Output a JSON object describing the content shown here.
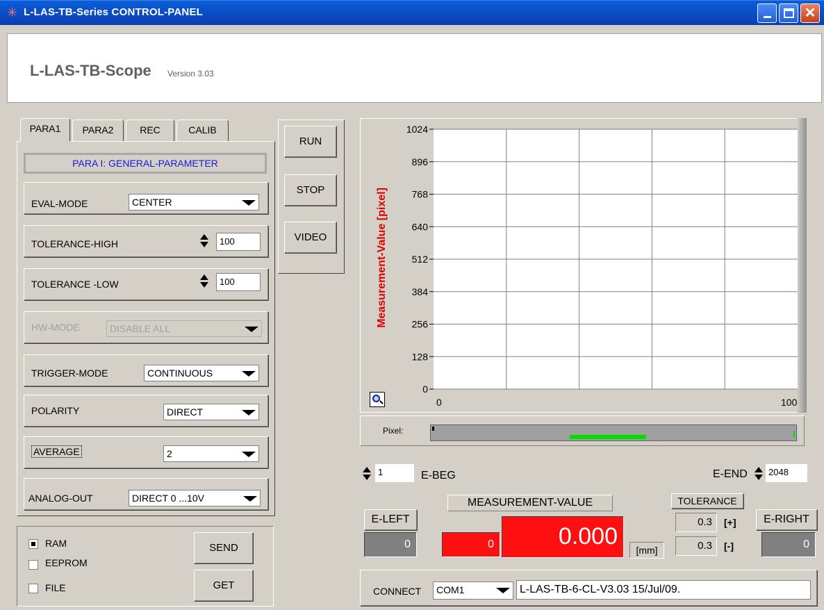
{
  "window": {
    "title": "L-LAS-TB-Series CONTROL-PANEL"
  },
  "header": {
    "title": "L-LAS-TB-Scope",
    "version": "Version 3.03"
  },
  "tabs": [
    "PARA1",
    "PARA2",
    "REC",
    "CALIB"
  ],
  "para_title": "PARA I: GENERAL-PARAMETER",
  "params": {
    "eval_mode": {
      "label": "EVAL-MODE",
      "value": "CENTER"
    },
    "tol_high": {
      "label": "TOLERANCE-HIGH",
      "value": "100"
    },
    "tol_low": {
      "label": "TOLERANCE -LOW",
      "value": "100"
    },
    "hw_mode": {
      "label": "HW-MODE",
      "value": "DISABLE ALL"
    },
    "trigger_mode": {
      "label": "TRIGGER-MODE",
      "value": "CONTINUOUS"
    },
    "polarity": {
      "label": "POLARITY",
      "value": "DIRECT"
    },
    "average": {
      "label": "AVERAGE",
      "value": "2"
    },
    "analog_out": {
      "label": "ANALOG-OUT",
      "value": "DIRECT 0 ...10V"
    }
  },
  "storage": {
    "ram": "RAM",
    "eeprom": "EEPROM",
    "file": "FILE",
    "ram_checked": true,
    "eeprom_checked": false,
    "file_checked": false
  },
  "buttons": {
    "send": "SEND",
    "get": "GET",
    "run": "RUN",
    "stop": "STOP",
    "video": "VIDEO"
  },
  "chart_data": {
    "type": "line",
    "ylabel": "Measurement-Value  [pixel]",
    "ylim": [
      0,
      1024
    ],
    "yticks": [
      "1024",
      "896",
      "768",
      "640",
      "512",
      "384",
      "256",
      "128",
      "0"
    ],
    "xlim": [
      0,
      100
    ],
    "xticks": [
      "0",
      "100"
    ],
    "grid": true,
    "series": []
  },
  "pixel_bar": {
    "label": "Pixel:",
    "green_start": 0.38,
    "green_end": 0.59
  },
  "e_beg": {
    "value": "1",
    "label": "E-BEG"
  },
  "e_end": {
    "value": "2048",
    "label": "E-END"
  },
  "measurement": {
    "label": "MEASUREMENT-VALUE",
    "raw": "0",
    "value": "0.000",
    "unit": "[mm]"
  },
  "e_left": {
    "label": "E-LEFT",
    "value": "0"
  },
  "e_right": {
    "label": "E-RIGHT",
    "value": "0"
  },
  "tolerance": {
    "label": "TOLERANCE",
    "plus": "0.3",
    "plus_label": "[+]",
    "minus": "0.3",
    "minus_label": "[-]"
  },
  "connect": {
    "label": "CONNECT",
    "port": "COM1",
    "info": "L-LAS-TB-6-CL-V3.03  15/Jul/09."
  },
  "colors": {
    "title_bar": "#0a4fc7",
    "red_display": "#ff1010",
    "y_label": "#e00000",
    "green_bar": "#00e000"
  }
}
